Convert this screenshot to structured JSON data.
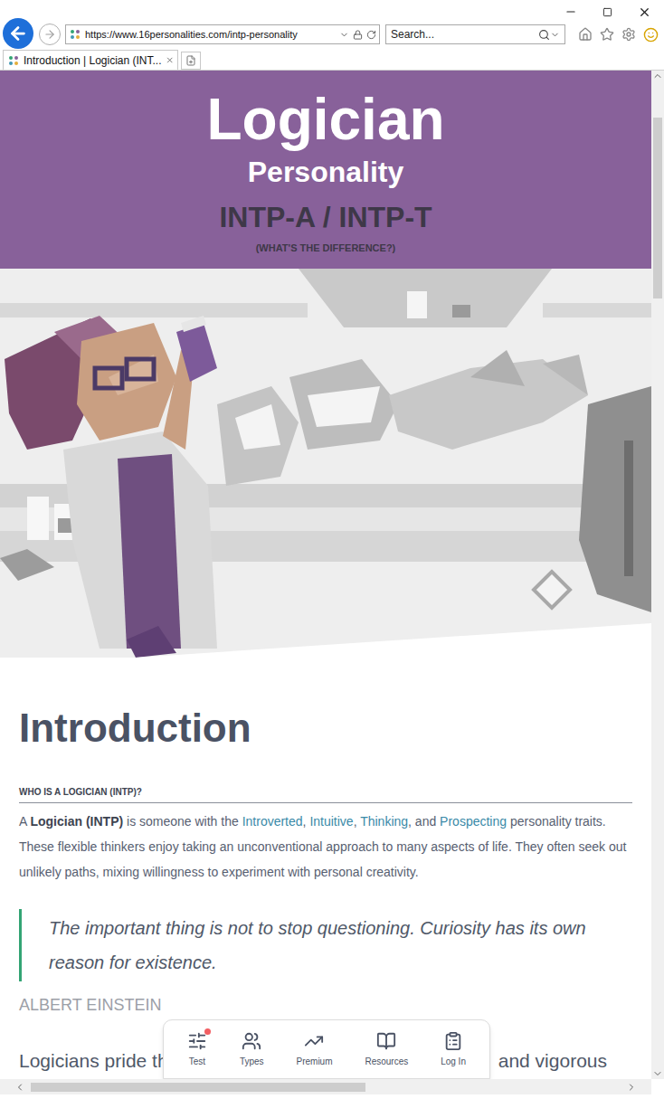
{
  "address_bar": {
    "url": "https://www.16personalities.com/intp-personality"
  },
  "search": {
    "placeholder": "Search..."
  },
  "tabs": [
    {
      "label": "Introduction | Logician (INT...",
      "selected": true
    }
  ],
  "header": {
    "title": "Logician",
    "subtitle": "Personality",
    "types": "INTP-A / INTP-T",
    "link": "(WHAT'S THE DIFFERENCE?)"
  },
  "article": {
    "heading": "Introduction",
    "section_label": "WHO IS A LOGICIAN (INTP)?",
    "intro": [
      {
        "text": "A ",
        "kind": "plain"
      },
      {
        "text": "Logician (INTP)",
        "kind": "bold"
      },
      {
        "text": " is someone with the ",
        "kind": "plain"
      },
      {
        "text": "Introverted",
        "kind": "link"
      },
      {
        "text": ", ",
        "kind": "plain"
      },
      {
        "text": "Intuitive",
        "kind": "link"
      },
      {
        "text": ", ",
        "kind": "plain"
      },
      {
        "text": "Thinking",
        "kind": "link"
      },
      {
        "text": ", and ",
        "kind": "plain"
      },
      {
        "text": "Prospecting",
        "kind": "link"
      },
      {
        "text": " personality traits. These flexible thinkers enjoy taking an unconventional approach to many aspects of life. They often seek out unlikely paths, mixing willingness to experiment with personal creativity.",
        "kind": "plain"
      }
    ],
    "quote": {
      "text": "The important thing is not to stop questioning. Curiosity has its own reason for existence.",
      "author": "ALBERT EINSTEIN"
    },
    "cut_line": {
      "left": "Logicians pride th",
      "right": "and vigorous"
    }
  },
  "bottom_nav": [
    {
      "label": "Test",
      "badge": true
    },
    {
      "label": "Types",
      "badge": false
    },
    {
      "label": "Premium",
      "badge": false
    },
    {
      "label": "Resources",
      "badge": false
    },
    {
      "label": "Log In",
      "badge": false
    }
  ]
}
